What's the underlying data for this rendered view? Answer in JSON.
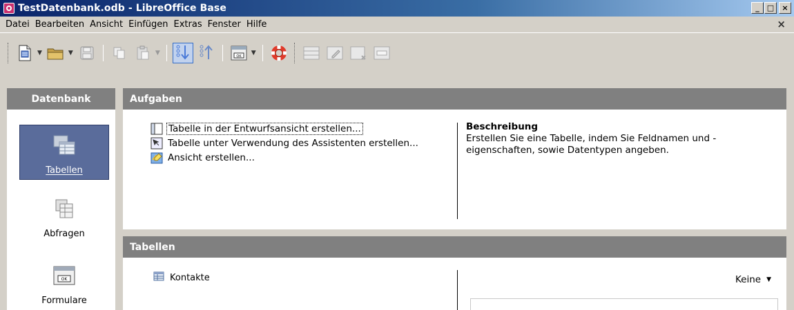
{
  "window": {
    "title": "TestDatenbank.odb - LibreOffice Base",
    "controls": [
      "_",
      "□",
      "×"
    ]
  },
  "menubar": {
    "items": [
      "Datei",
      "Bearbeiten",
      "Ansicht",
      "Einfügen",
      "Extras",
      "Fenster",
      "Hilfe"
    ],
    "close": "×"
  },
  "toolbar": {
    "buttons": [
      "new-document-icon",
      "open-folder-icon",
      "save-icon",
      "copy-icon",
      "paste-icon",
      "sort-ascending-icon",
      "sort-descending-icon",
      "form-control-icon",
      "help-lifebuoy-icon",
      "open-database-object-icon",
      "edit-icon",
      "delete-icon",
      "rename-icon"
    ]
  },
  "sidebar": {
    "header": "Datenbank",
    "items": [
      {
        "label": "Tabellen",
        "selected": true
      },
      {
        "label": "Abfragen",
        "selected": false
      },
      {
        "label": "Formulare",
        "selected": false
      }
    ]
  },
  "tasks": {
    "header": "Aufgaben",
    "items": [
      {
        "label": "Tabelle in der Entwurfsansicht erstellen...",
        "icon": "table-design-icon"
      },
      {
        "label": "Tabelle unter Verwendung des Assistenten erstellen...",
        "icon": "table-wizard-icon"
      },
      {
        "label": "Ansicht erstellen...",
        "icon": "view-create-icon"
      }
    ],
    "description_title": "Beschreibung",
    "description_text": "Erstellen Sie eine Tabelle, indem Sie Feldnamen und -eigenschaften, sowie Datentypen angeben."
  },
  "tables": {
    "header": "Tabellen",
    "items": [
      {
        "label": "Kontakte"
      }
    ],
    "preview_option": "Keine"
  },
  "colors": {
    "panel_header": "#808080",
    "selected_nav": "#5a6c9b",
    "titlebar_start": "#0a246a"
  }
}
